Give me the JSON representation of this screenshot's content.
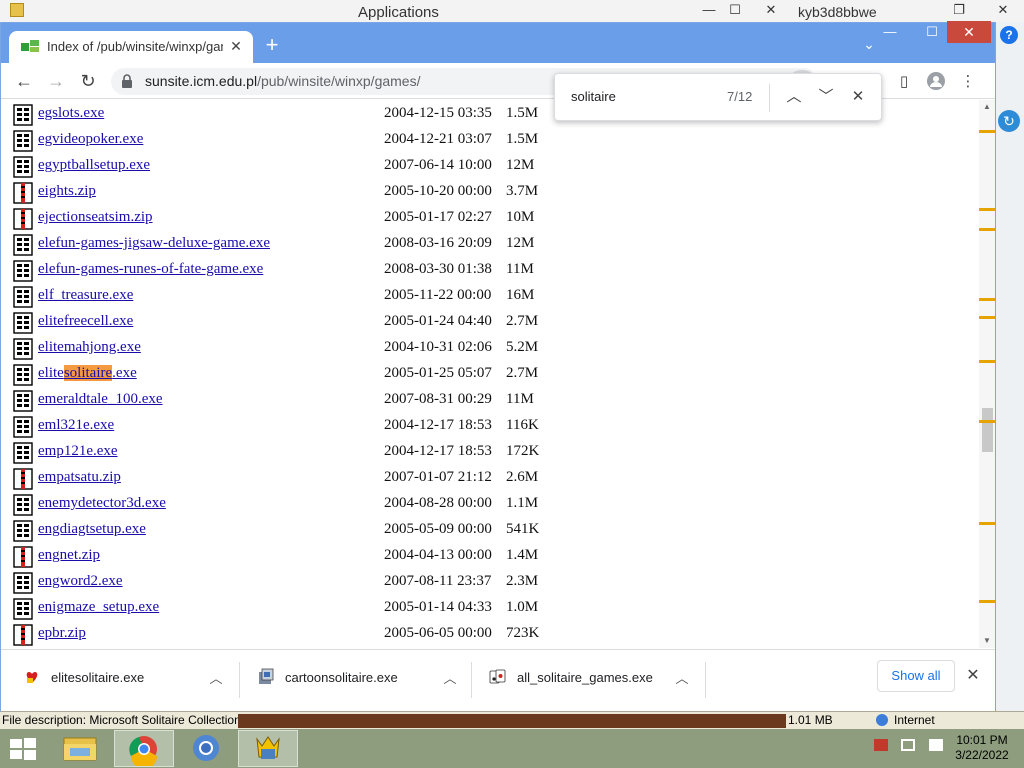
{
  "background": {
    "title": "Applications",
    "user": "kyb3d8bbwe"
  },
  "browser": {
    "tab_title": "Index of /pub/winsite/winxp/games/",
    "url_host": "sunsite.icm.edu.pl",
    "url_path": "/pub/winsite/winxp/games/"
  },
  "find": {
    "query": "solitaire",
    "count": "7/12"
  },
  "files": [
    {
      "pre": "egslots.exe",
      "hl": "",
      "post": "",
      "date": "2004-12-15 03:35",
      "size": "1.5M",
      "type": "exe"
    },
    {
      "pre": "egvideopoker.exe",
      "hl": "",
      "post": "",
      "date": "2004-12-21 03:07",
      "size": "1.5M",
      "type": "exe"
    },
    {
      "pre": "egyptballsetup.exe",
      "hl": "",
      "post": "",
      "date": "2007-06-14 10:00",
      "size": "12M",
      "type": "exe"
    },
    {
      "pre": "eights.zip",
      "hl": "",
      "post": "",
      "date": "2005-10-20 00:00",
      "size": "3.7M",
      "type": "zip"
    },
    {
      "pre": "ejectionseatsim.zip",
      "hl": "",
      "post": "",
      "date": "2005-01-17 02:27",
      "size": "10M",
      "type": "zip"
    },
    {
      "pre": "elefun-games-jigsaw-deluxe-game.exe",
      "hl": "",
      "post": "",
      "date": "2008-03-16 20:09",
      "size": "12M",
      "type": "exe"
    },
    {
      "pre": "elefun-games-runes-of-fate-game.exe",
      "hl": "",
      "post": "",
      "date": "2008-03-30 01:38",
      "size": "11M",
      "type": "exe"
    },
    {
      "pre": "elf_treasure.exe",
      "hl": "",
      "post": "",
      "date": "2005-11-22 00:00",
      "size": "16M",
      "type": "exe"
    },
    {
      "pre": "elitefreecell.exe",
      "hl": "",
      "post": "",
      "date": "2005-01-24 04:40",
      "size": "2.7M",
      "type": "exe"
    },
    {
      "pre": "elitemahjong.exe",
      "hl": "",
      "post": "",
      "date": "2004-10-31 02:06",
      "size": "5.2M",
      "type": "exe"
    },
    {
      "pre": "elite",
      "hl": "solitaire",
      "post": ".exe",
      "date": "2005-01-25 05:07",
      "size": "2.7M",
      "type": "exe"
    },
    {
      "pre": "emeraldtale_100.exe",
      "hl": "",
      "post": "",
      "date": "2007-08-31 00:29",
      "size": "11M",
      "type": "exe"
    },
    {
      "pre": "eml321e.exe",
      "hl": "",
      "post": "",
      "date": "2004-12-17 18:53",
      "size": "116K",
      "type": "exe"
    },
    {
      "pre": "emp121e.exe",
      "hl": "",
      "post": "",
      "date": "2004-12-17 18:53",
      "size": "172K",
      "type": "exe"
    },
    {
      "pre": "empatsatu.zip",
      "hl": "",
      "post": "",
      "date": "2007-01-07 21:12",
      "size": "2.6M",
      "type": "zip"
    },
    {
      "pre": "enemydetector3d.exe",
      "hl": "",
      "post": "",
      "date": "2004-08-28 00:00",
      "size": "1.1M",
      "type": "exe"
    },
    {
      "pre": "engdiagtsetup.exe",
      "hl": "",
      "post": "",
      "date": "2005-05-09 00:00",
      "size": "541K",
      "type": "exe"
    },
    {
      "pre": "engnet.zip",
      "hl": "",
      "post": "",
      "date": "2004-04-13 00:00",
      "size": "1.4M",
      "type": "zip"
    },
    {
      "pre": "engword2.exe",
      "hl": "",
      "post": "",
      "date": "2007-08-11 23:37",
      "size": "2.3M",
      "type": "exe"
    },
    {
      "pre": "enigmaze_setup.exe",
      "hl": "",
      "post": "",
      "date": "2005-01-14 04:33",
      "size": "1.0M",
      "type": "exe"
    },
    {
      "pre": "epbr.zip",
      "hl": "",
      "post": "",
      "date": "2005-06-05 00:00",
      "size": "723K",
      "type": "zip"
    }
  ],
  "downloads": {
    "items": [
      "elitesolitaire.exe",
      "cartoonsolitaire.exe",
      "all_solitaire_games.exe"
    ],
    "show_all": "Show all"
  },
  "status": {
    "description": "File description: Microsoft Solitaire Collection",
    "size": "1.01 MB",
    "zone": "Internet"
  },
  "clock": {
    "time": "10:01 PM",
    "date": "3/22/2022"
  },
  "icons": {
    "exe": "exe-file-icon",
    "zip": "zip-file-icon"
  },
  "colors": {
    "tab_strip": "#6b9ee8",
    "link": "#1a0dab",
    "find_highlight": "#f49a40",
    "find_marker": "#e5a400",
    "taskbar": "#8d9d7d"
  }
}
